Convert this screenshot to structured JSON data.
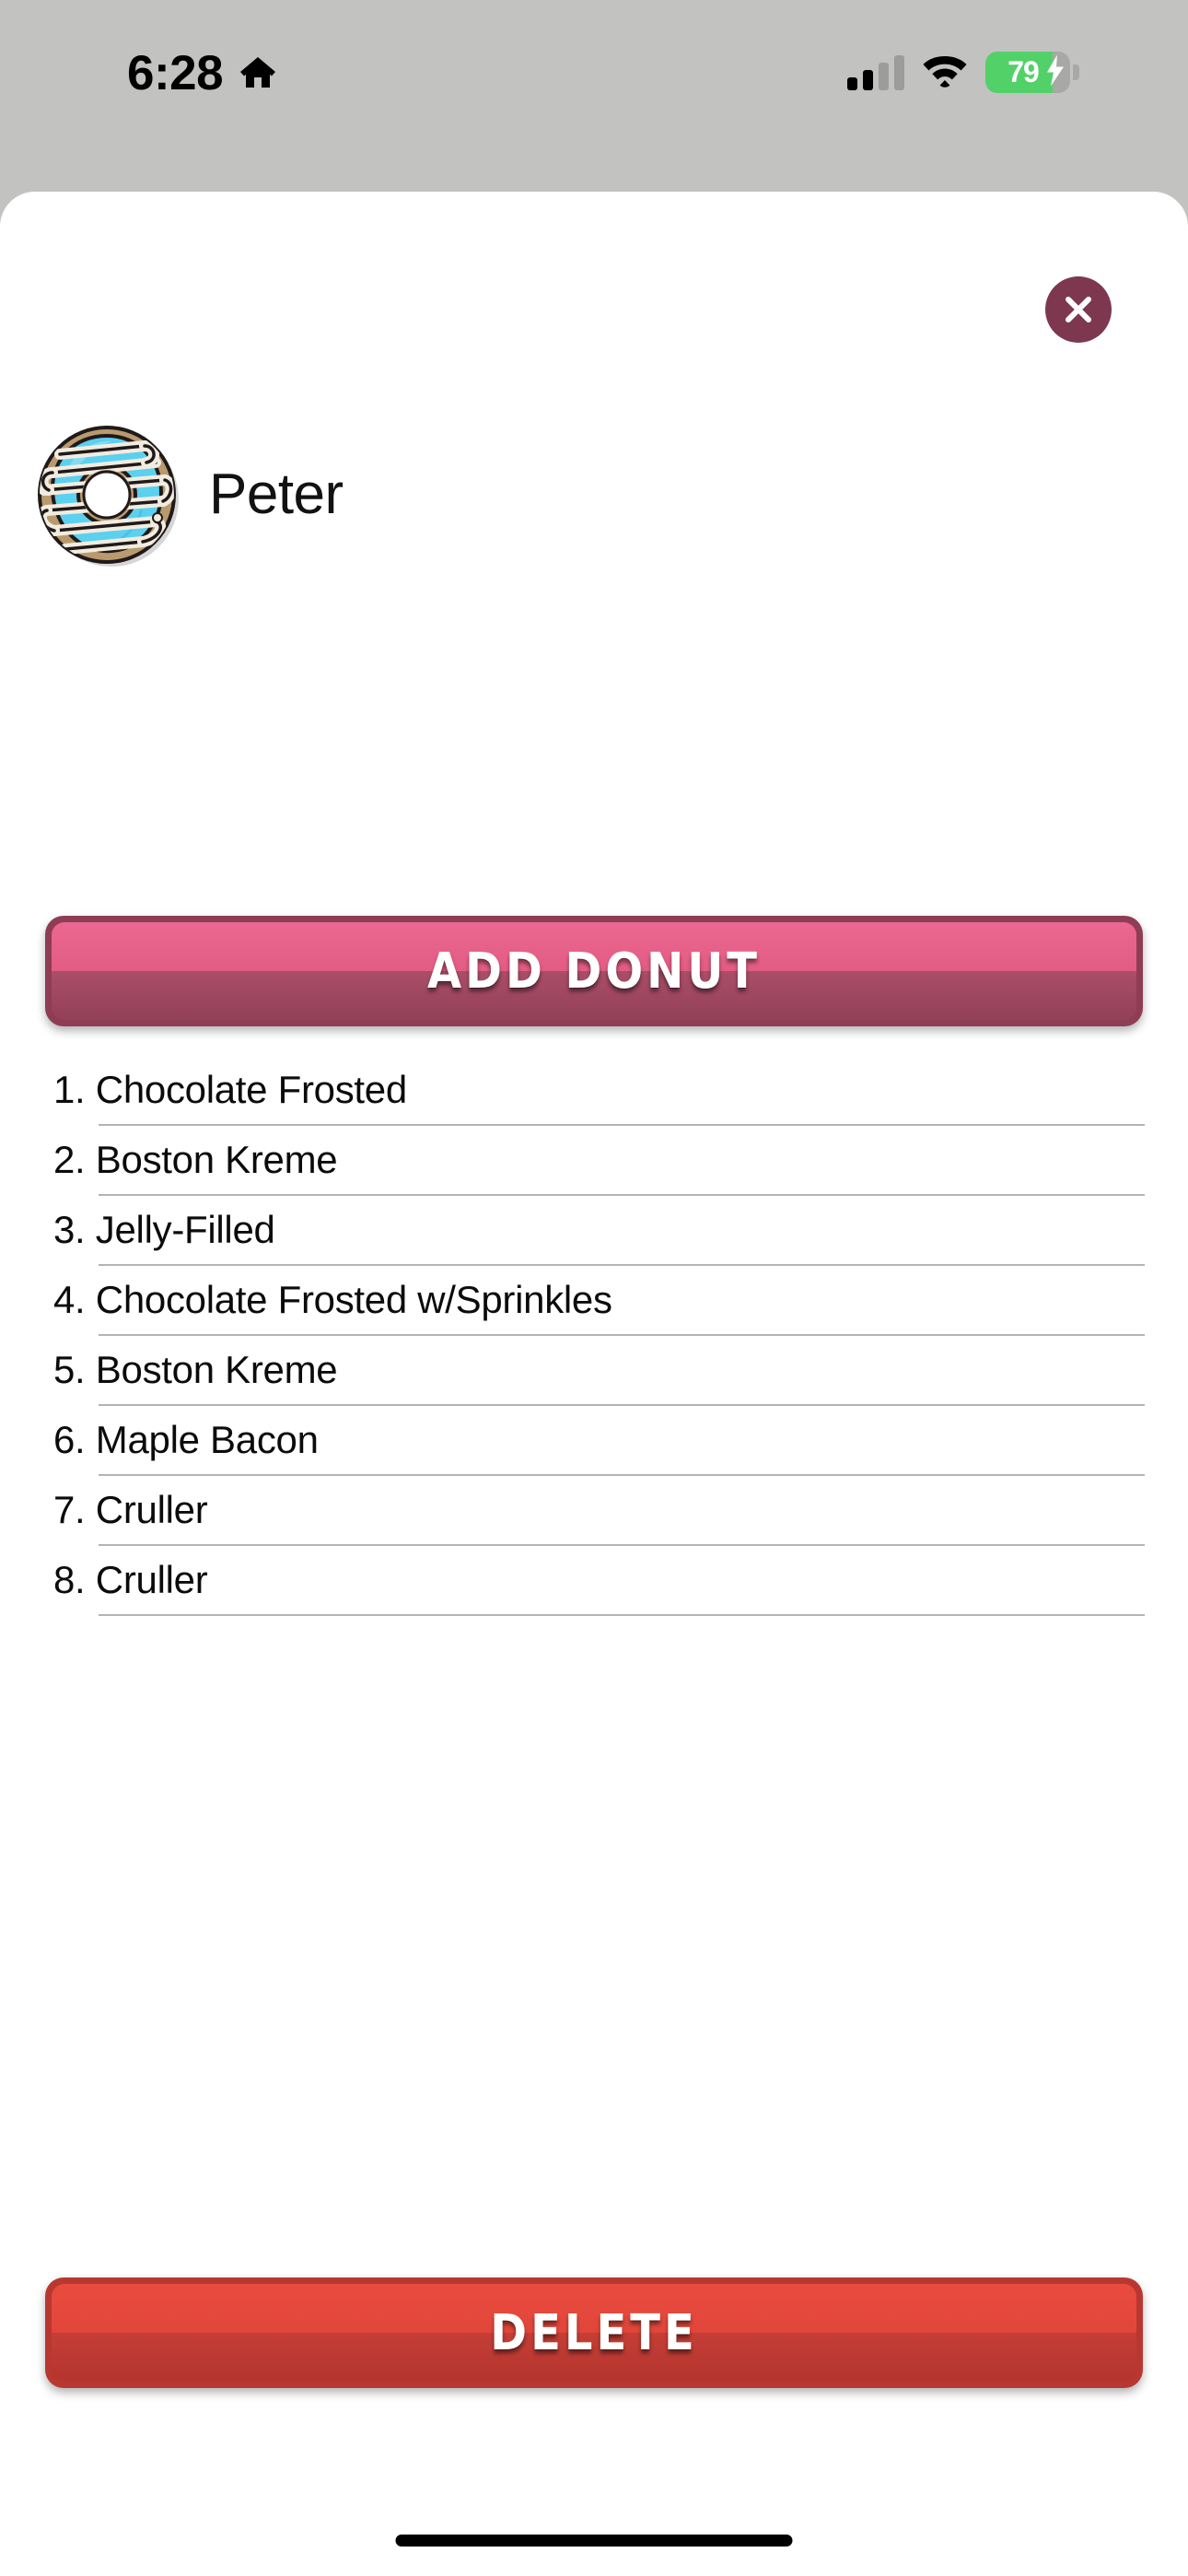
{
  "status_bar": {
    "time": "6:28",
    "home_icon": "home-icon",
    "signal_icon": "cellular-signal-icon",
    "wifi_icon": "wifi-icon",
    "battery_percent": "79",
    "battery_level": 79,
    "battery_charging": true,
    "battery_color": "#53d169"
  },
  "sheet": {
    "close_label": "✕",
    "background": "#ffffff"
  },
  "profile": {
    "name": "Peter",
    "avatar_icon": "donut-avatar",
    "avatar_frosting_color": "#5bd0ef",
    "avatar_dough_color": "#b99a6e",
    "avatar_drizzle_color": "#f2ece0"
  },
  "actions": {
    "add_label": "ADD  DONUT",
    "add_color_top": "#ec6792",
    "add_color_bottom": "#93405a",
    "delete_label": "DELETE",
    "delete_color_top": "#ea4b3e",
    "delete_color_bottom": "#b3352e"
  },
  "donut_list": {
    "items": [
      {
        "index": "1.",
        "name": "Chocolate Frosted",
        "text": "1. Chocolate Frosted"
      },
      {
        "index": "2.",
        "name": "Boston Kreme",
        "text": "2. Boston Kreme"
      },
      {
        "index": "3.",
        "name": "Jelly-Filled",
        "text": "3. Jelly-Filled"
      },
      {
        "index": "4.",
        "name": "Chocolate Frosted w/Sprinkles",
        "text": "4. Chocolate Frosted w/Sprinkles"
      },
      {
        "index": "5.",
        "name": "Boston Kreme",
        "text": "5. Boston Kreme"
      },
      {
        "index": "6.",
        "name": "Maple Bacon",
        "text": "6. Maple Bacon"
      },
      {
        "index": "7.",
        "name": "Cruller",
        "text": "7. Cruller"
      },
      {
        "index": "8.",
        "name": "Cruller",
        "text": "8. Cruller"
      }
    ],
    "count": 8
  },
  "system": {
    "home_indicator": "home-indicator",
    "backdrop_color": "#bdbdbc"
  }
}
